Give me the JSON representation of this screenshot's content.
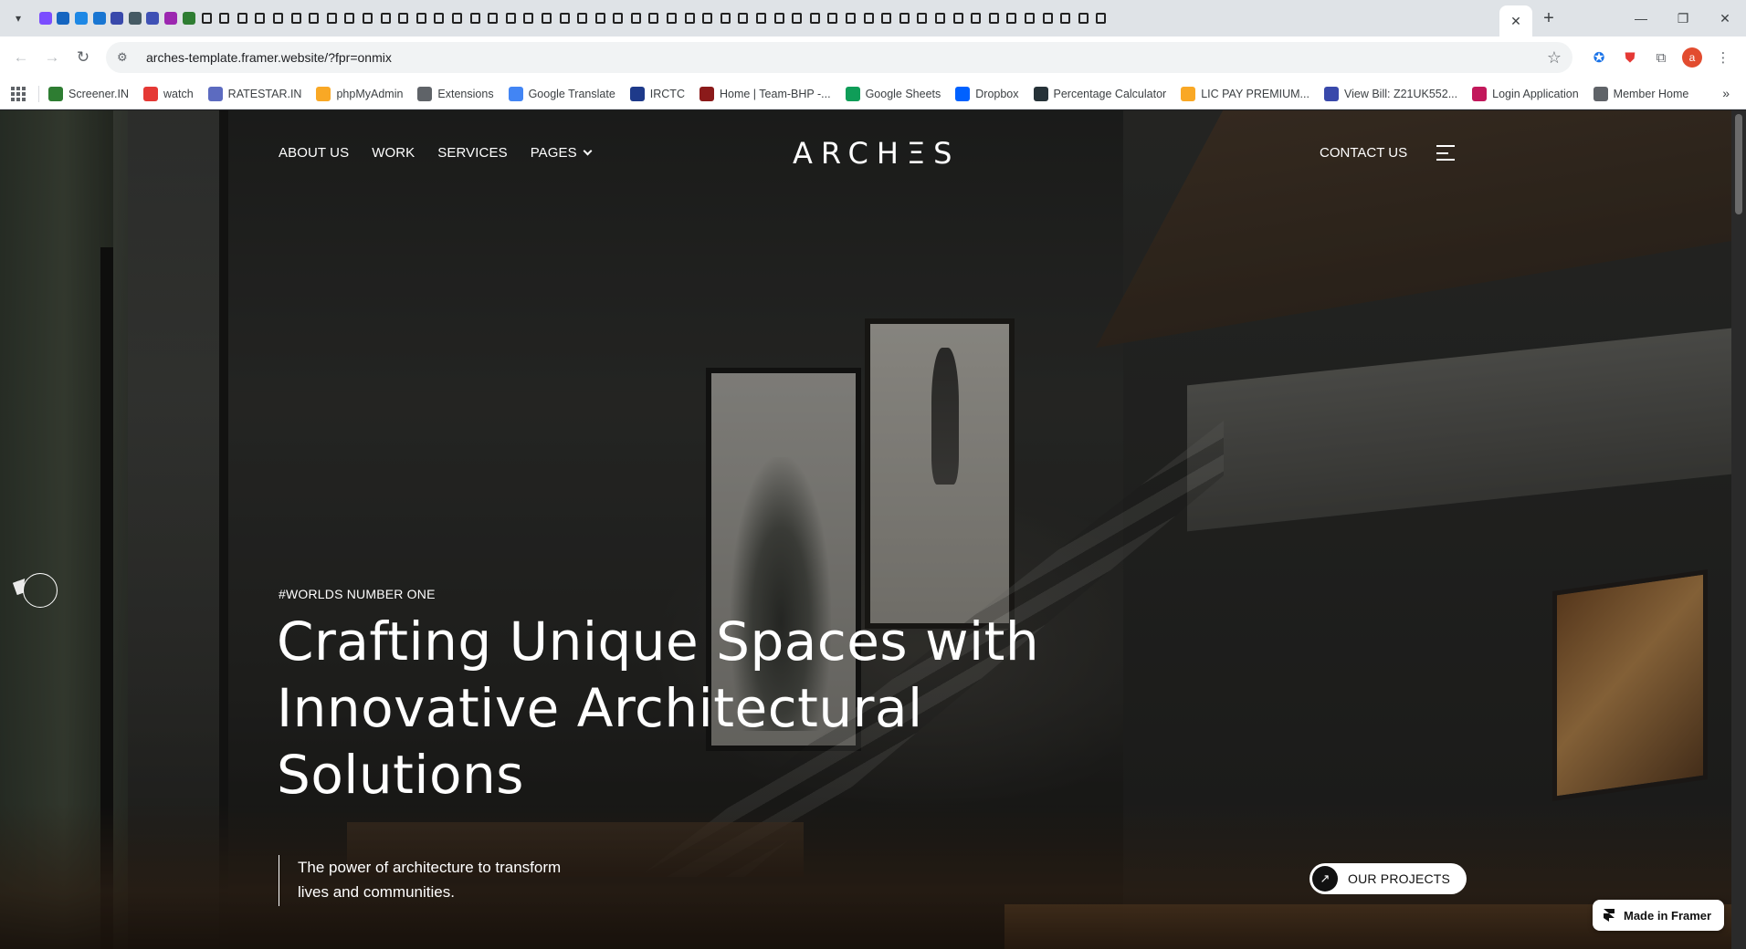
{
  "browser": {
    "url": "arches-template.framer.website/?fpr=onmix",
    "tab_count_visible": 60,
    "profile_initial": "a",
    "bookmarks": [
      {
        "label": "Screener.IN",
        "icon": "bar-chart-icon",
        "color": "#2e7d32"
      },
      {
        "label": "watch",
        "icon": "youtube-icon",
        "color": "#e53935"
      },
      {
        "label": "RATESTAR.IN",
        "icon": "ratestar-icon",
        "color": "#5c6bc0"
      },
      {
        "label": "phpMyAdmin",
        "icon": "phpmyadmin-icon",
        "color": "#f9a825"
      },
      {
        "label": "Extensions",
        "icon": "puzzle-icon",
        "color": "#5f6368"
      },
      {
        "label": "Google Translate",
        "icon": "translate-icon",
        "color": "#4285f4"
      },
      {
        "label": "IRCTC",
        "icon": "irctc-icon",
        "color": "#1e3a8a"
      },
      {
        "label": "Home | Team-BHP -...",
        "icon": "teambhp-icon",
        "color": "#8b1a1a"
      },
      {
        "label": "Google Sheets",
        "icon": "sheets-icon",
        "color": "#0f9d58"
      },
      {
        "label": "Dropbox",
        "icon": "dropbox-icon",
        "color": "#0061ff"
      },
      {
        "label": "Percentage Calculator",
        "icon": "percent-icon",
        "color": "#263238"
      },
      {
        "label": "LIC PAY PREMIUM...",
        "icon": "lic-icon",
        "color": "#f9a825"
      },
      {
        "label": "View Bill: Z21UK552...",
        "icon": "bill-icon",
        "color": "#3949ab"
      },
      {
        "label": "Login Application",
        "icon": "login-icon",
        "color": "#c2185b"
      },
      {
        "label": "Member Home",
        "icon": "globe-icon",
        "color": "#5f6368"
      }
    ]
  },
  "site": {
    "nav": {
      "about": "ABOUT US",
      "work": "WORK",
      "services": "SERVICES",
      "pages": "PAGES",
      "logo": "ARCHΞS",
      "contact": "CONTACT US"
    },
    "hero": {
      "kicker": "#WORLDS NUMBER ONE",
      "headline_line1": "Crafting Unique Spaces with",
      "headline_line2": "Innovative Architectural",
      "headline_line3": "Solutions",
      "subtext_line1": "The power of architecture to transform",
      "subtext_line2": "lives and communities.",
      "cta_label": "OUR PROJECTS",
      "cta_icon": "arrow-up-right-icon"
    },
    "badge": {
      "label": "Made in Framer",
      "icon": "framer-icon"
    }
  },
  "colors": {
    "accent": "#ffffff",
    "overlay": "#000000",
    "browser_chrome": "#dfe3e7"
  }
}
